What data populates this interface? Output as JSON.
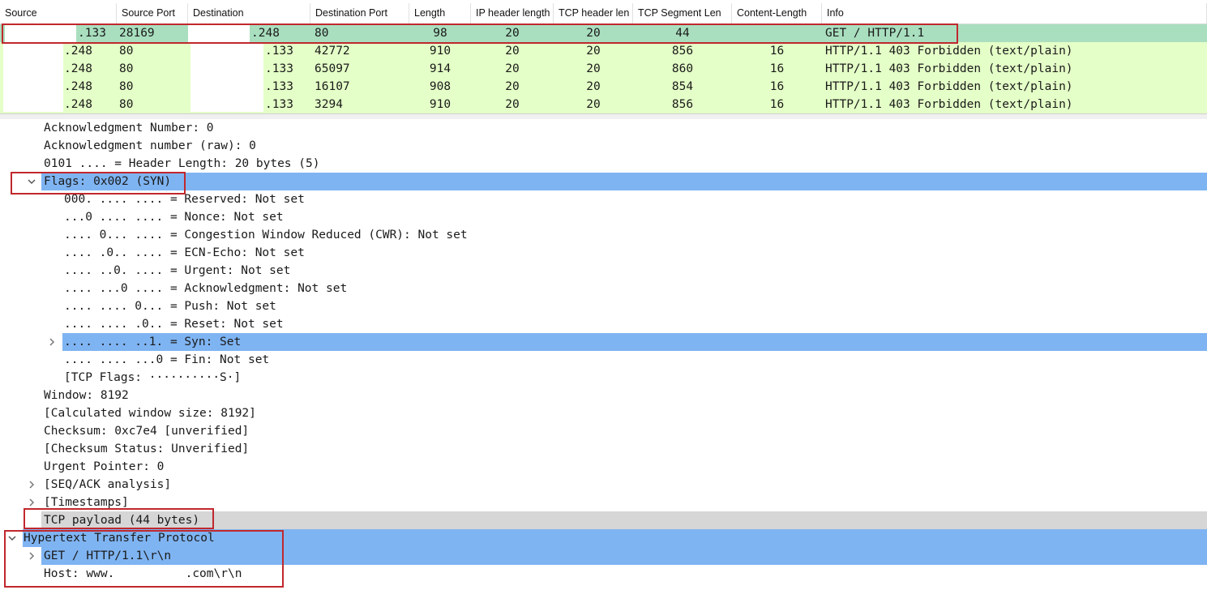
{
  "packet_list": {
    "columns": [
      "Source",
      "Source Port",
      "Destination",
      "Destination Port",
      "Length",
      "IP header length",
      "TCP header len",
      "TCP Segment Len",
      "Content-Length",
      "Info"
    ],
    "rows": [
      {
        "src": ".133",
        "sport": "28169",
        "dst": ".248",
        "dport": "80",
        "len": "98",
        "iphl": "20",
        "tcphl": "20",
        "seglen": "44",
        "clen": "",
        "info": "GET / HTTP/1.1",
        "bg": "#a9dfbf"
      },
      {
        "src": ".248",
        "sport": "80",
        "dst": ".133",
        "dport": "42772",
        "len": "910",
        "iphl": "20",
        "tcphl": "20",
        "seglen": "856",
        "clen": "16",
        "info": "HTTP/1.1 403 Forbidden  (text/plain)",
        "bg": "#e4ffc7"
      },
      {
        "src": ".248",
        "sport": "80",
        "dst": ".133",
        "dport": "65097",
        "len": "914",
        "iphl": "20",
        "tcphl": "20",
        "seglen": "860",
        "clen": "16",
        "info": "HTTP/1.1 403 Forbidden  (text/plain)",
        "bg": "#e4ffc7"
      },
      {
        "src": ".248",
        "sport": "80",
        "dst": ".133",
        "dport": "16107",
        "len": "908",
        "iphl": "20",
        "tcphl": "20",
        "seglen": "854",
        "clen": "16",
        "info": "HTTP/1.1 403 Forbidden  (text/plain)",
        "bg": "#e4ffc7"
      },
      {
        "src": ".248",
        "sport": "80",
        "dst": ".133",
        "dport": "3294",
        "len": "910",
        "iphl": "20",
        "tcphl": "20",
        "seglen": "856",
        "clen": "16",
        "info": "HTTP/1.1 403 Forbidden  (text/plain)",
        "bg": "#e4ffc7"
      }
    ]
  },
  "detail": {
    "lines": [
      {
        "text": "Acknowledgment Number: 0",
        "indent": 1,
        "arrow": "",
        "hl": ""
      },
      {
        "text": "Acknowledgment number (raw): 0",
        "indent": 1,
        "arrow": "",
        "hl": ""
      },
      {
        "text": "0101 .... = Header Length: 20 bytes (5)",
        "indent": 1,
        "arrow": "",
        "hl": ""
      },
      {
        "text": "Flags: 0x002 (SYN)",
        "indent": 1,
        "arrow": "expanded",
        "hl": "blue"
      },
      {
        "text": "000. .... .... = Reserved: Not set",
        "indent": 2,
        "arrow": "",
        "hl": ""
      },
      {
        "text": "...0 .... .... = Nonce: Not set",
        "indent": 2,
        "arrow": "",
        "hl": ""
      },
      {
        "text": ".... 0... .... = Congestion Window Reduced (CWR): Not set",
        "indent": 2,
        "arrow": "",
        "hl": ""
      },
      {
        "text": ".... .0.. .... = ECN-Echo: Not set",
        "indent": 2,
        "arrow": "",
        "hl": ""
      },
      {
        "text": ".... ..0. .... = Urgent: Not set",
        "indent": 2,
        "arrow": "",
        "hl": ""
      },
      {
        "text": ".... ...0 .... = Acknowledgment: Not set",
        "indent": 2,
        "arrow": "",
        "hl": ""
      },
      {
        "text": ".... .... 0... = Push: Not set",
        "indent": 2,
        "arrow": "",
        "hl": ""
      },
      {
        "text": ".... .... .0.. = Reset: Not set",
        "indent": 2,
        "arrow": "",
        "hl": ""
      },
      {
        "text": ".... .... ..1. = Syn: Set",
        "indent": 2,
        "arrow": "collapsed",
        "hl": "blue"
      },
      {
        "text": ".... .... ...0 = Fin: Not set",
        "indent": 2,
        "arrow": "",
        "hl": ""
      },
      {
        "text": "[TCP Flags: ··········S·]",
        "indent": 2,
        "arrow": "",
        "hl": ""
      },
      {
        "text": "Window: 8192",
        "indent": 1,
        "arrow": "",
        "hl": ""
      },
      {
        "text": "[Calculated window size: 8192]",
        "indent": 1,
        "arrow": "",
        "hl": ""
      },
      {
        "text": "Checksum: 0xc7e4 [unverified]",
        "indent": 1,
        "arrow": "",
        "hl": ""
      },
      {
        "text": "[Checksum Status: Unverified]",
        "indent": 1,
        "arrow": "",
        "hl": ""
      },
      {
        "text": "Urgent Pointer: 0",
        "indent": 1,
        "arrow": "",
        "hl": ""
      },
      {
        "text": "[SEQ/ACK analysis]",
        "indent": 1,
        "arrow": "collapsed",
        "hl": ""
      },
      {
        "text": "[Timestamps]",
        "indent": 1,
        "arrow": "collapsed",
        "hl": ""
      },
      {
        "text": "TCP payload (44 bytes)",
        "indent": 1,
        "arrow": "",
        "hl": "gray"
      },
      {
        "text": "Hypertext Transfer Protocol",
        "indent": 0,
        "arrow": "expanded",
        "hl": "blue"
      },
      {
        "text": "GET / HTTP/1.1\\r\\n",
        "indent": 1,
        "arrow": "collapsed",
        "hl": "blue"
      },
      {
        "text": "Host: www.          .com\\r\\n",
        "indent": 1,
        "arrow": "",
        "hl": ""
      }
    ]
  },
  "colors": {
    "selected_row": "#a9dfbf",
    "http_row": "#e4ffc7",
    "tree_highlight": "#7fb4f2",
    "payload_highlight": "#d6d6d6",
    "annotation_box": "#c0282d"
  }
}
